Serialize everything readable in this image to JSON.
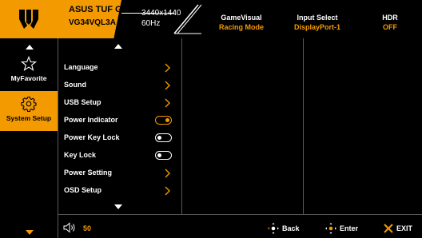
{
  "header": {
    "brand": "ASUS TUF GAMING",
    "model": "VG34VQL3A",
    "resolution": "3440x1440",
    "refresh": "60Hz",
    "status": [
      {
        "label": "GameVisual",
        "value": "Racing Mode"
      },
      {
        "label": "Input Select",
        "value": "DisplayPort-1"
      },
      {
        "label": "HDR",
        "value": "OFF"
      }
    ]
  },
  "sidebar": {
    "items": [
      {
        "label": "MyFavorite",
        "icon": "star-icon",
        "selected": false
      },
      {
        "label": "System Setup",
        "icon": "gear-icon",
        "selected": true
      }
    ]
  },
  "menu": {
    "items": [
      {
        "label": "Language",
        "control": "chevron"
      },
      {
        "label": "Sound",
        "control": "chevron"
      },
      {
        "label": "USB Setup",
        "control": "chevron"
      },
      {
        "label": "Power Indicator",
        "control": "toggle-on"
      },
      {
        "label": "Power Key Lock",
        "control": "toggle-off"
      },
      {
        "label": "Key Lock",
        "control": "toggle-off"
      },
      {
        "label": "Power Setting",
        "control": "chevron"
      },
      {
        "label": "OSD Setup",
        "control": "chevron"
      }
    ]
  },
  "footer": {
    "volume": "50",
    "back_label": "Back",
    "enter_label": "Enter",
    "exit_label": "EXIT"
  },
  "colors": {
    "accent": "#f39a00",
    "background": "#000000",
    "divider": "#5a5a5a"
  }
}
